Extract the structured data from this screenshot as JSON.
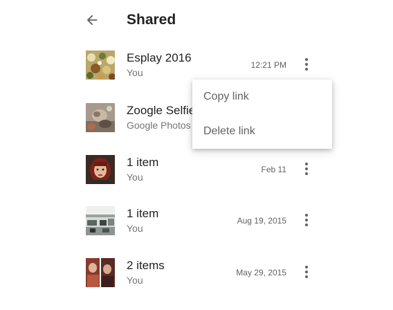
{
  "header": {
    "title": "Shared"
  },
  "items": [
    {
      "title": "Esplay 2016",
      "subtitle": "You",
      "time": "12:21 PM"
    },
    {
      "title": "Zoogle Selfie",
      "subtitle": "Google Photos",
      "time": ""
    },
    {
      "title": "1 item",
      "subtitle": "You",
      "time": "Feb 11"
    },
    {
      "title": "1 item",
      "subtitle": "You",
      "time": "Aug 19, 2015"
    },
    {
      "title": "2 items",
      "subtitle": "You",
      "time": "May 29, 2015"
    }
  ],
  "menu": {
    "items": [
      {
        "label": "Copy link"
      },
      {
        "label": "Delete link"
      }
    ]
  },
  "colors": {
    "primary_text": "#212121",
    "secondary_text": "#757575",
    "icon": "#616161",
    "background": "#ffffff"
  }
}
